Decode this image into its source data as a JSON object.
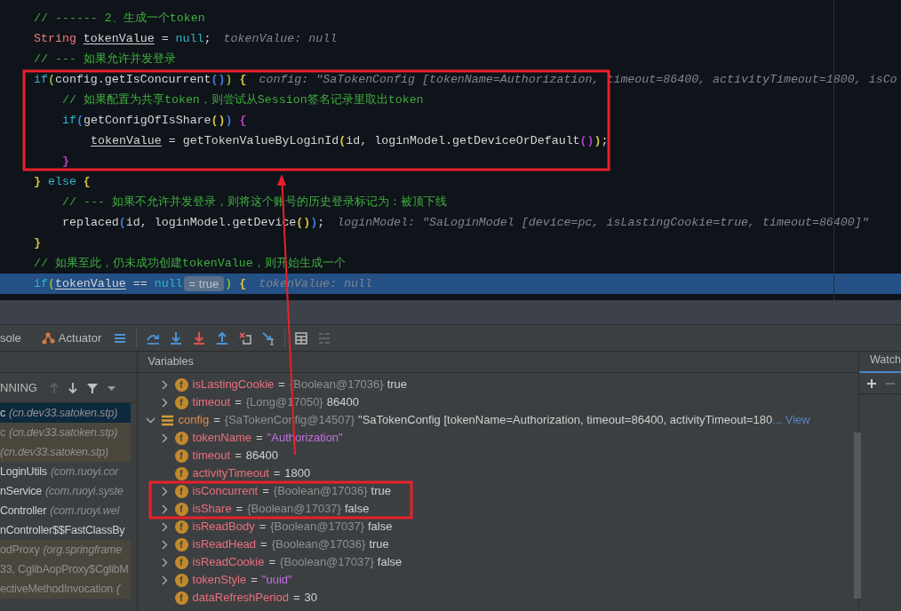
{
  "editor": {
    "lines": [
      {
        "highlighted": false,
        "tokens": [
          {
            "kind": "comment",
            "text": "// ------ 2、生成一个token"
          }
        ]
      },
      {
        "highlighted": false,
        "tokens": [
          {
            "kind": "type",
            "text": "String "
          },
          {
            "kind": "var",
            "text": "tokenValue"
          },
          {
            "kind": "plain",
            "text": " = "
          },
          {
            "kind": "keyword",
            "text": "null"
          },
          {
            "kind": "plain",
            "text": ";"
          },
          {
            "kind": "hint",
            "text": "tokenValue: null"
          }
        ]
      },
      {
        "highlighted": false,
        "tokens": [
          {
            "kind": "comment",
            "text": "// --- 如果允许并发登录"
          }
        ]
      },
      {
        "highlighted": false,
        "tokens": [
          {
            "kind": "keyword",
            "text": "if"
          },
          {
            "kind": "bracket",
            "text": "(",
            "color": "#7fb83a"
          },
          {
            "kind": "plain",
            "text": "config.getIsConcurrent"
          },
          {
            "kind": "bracket",
            "text": "()",
            "color": "#3d7dd8"
          },
          {
            "kind": "bracket",
            "text": ")",
            "color": "#7fb83a"
          },
          {
            "kind": "bracket",
            "text": " {",
            "color": "#d6c43a"
          },
          {
            "kind": "hint",
            "text": "config: \"SaTokenConfig [tokenName=Authorization, timeout=86400, activityTimeout=1800, isCo"
          }
        ],
        "children": [
          {
            "highlighted": false,
            "tokens": [
              {
                "kind": "comment",
                "text": "// 如果配置为共享token，则尝试从Session签名记录里取出token"
              }
            ]
          },
          {
            "highlighted": false,
            "tokens": [
              {
                "kind": "keyword",
                "text": "if"
              },
              {
                "kind": "bracket",
                "text": "(",
                "color": "#3d7dd8"
              },
              {
                "kind": "plain",
                "text": "getConfigOfIsShare"
              },
              {
                "kind": "bracket",
                "text": "()",
                "color": "#d6c43a"
              },
              {
                "kind": "bracket",
                "text": ")",
                "color": "#3d7dd8"
              },
              {
                "kind": "bracket",
                "text": " {",
                "color": "#c73cc7"
              }
            ],
            "children": [
              {
                "highlighted": false,
                "tokens": [
                  {
                    "kind": "var",
                    "text": "tokenValue"
                  },
                  {
                    "kind": "plain",
                    "text": " = getTokenValueByLoginId"
                  },
                  {
                    "kind": "bracket",
                    "text": "(",
                    "color": "#d6c43a"
                  },
                  {
                    "kind": "plain",
                    "text": "id, loginModel.getDeviceOrDefault"
                  },
                  {
                    "kind": "bracket",
                    "text": "()",
                    "color": "#b03cd0"
                  },
                  {
                    "kind": "bracket",
                    "text": ")",
                    "color": "#d6c43a"
                  },
                  {
                    "kind": "plain",
                    "text": ";"
                  }
                ]
              }
            ]
          },
          {
            "highlighted": false,
            "tokens": [
              {
                "kind": "bracket",
                "text": "}",
                "color": "#c73cc7"
              }
            ]
          }
        ]
      },
      {
        "highlighted": false,
        "tokens": [
          {
            "kind": "bracket",
            "text": "}",
            "color": "#d6c43a"
          },
          {
            "kind": "keyword",
            "text": " else"
          },
          {
            "kind": "bracket",
            "text": " {",
            "color": "#d6c43a"
          }
        ],
        "children": [
          {
            "highlighted": false,
            "tokens": [
              {
                "kind": "comment",
                "text": "// --- 如果不允许并发登录，则将这个账号的历史登录标记为：被顶下线"
              }
            ]
          },
          {
            "highlighted": false,
            "tokens": [
              {
                "kind": "plain",
                "text": "replaced"
              },
              {
                "kind": "bracket",
                "text": "(",
                "color": "#3d7dd8"
              },
              {
                "kind": "plain",
                "text": "id, loginModel.getDevice"
              },
              {
                "kind": "bracket",
                "text": "()",
                "color": "#d6c43a"
              },
              {
                "kind": "bracket",
                "text": ")",
                "color": "#3d7dd8"
              },
              {
                "kind": "plain",
                "text": ";"
              },
              {
                "kind": "hint",
                "text": "loginModel: \"SaLoginModel [device=pc, isLastingCookie=true, timeout=86400]\""
              }
            ]
          }
        ]
      },
      {
        "highlighted": false,
        "tokens": [
          {
            "kind": "bracket",
            "text": "}",
            "color": "#d6c43a"
          }
        ]
      },
      {
        "highlighted": false,
        "tokens": [
          {
            "kind": "comment",
            "text": "// 如果至此，仍未成功创建tokenValue，则开始生成一个"
          }
        ]
      },
      {
        "highlighted": true,
        "tokens": [
          {
            "kind": "keyword",
            "text": "if"
          },
          {
            "kind": "bracket",
            "text": "(",
            "color": "#7fb83a"
          },
          {
            "kind": "var",
            "text": "tokenValue"
          },
          {
            "kind": "plain",
            "text": " == "
          },
          {
            "kind": "keyword",
            "text": "null"
          },
          {
            "kind": "inline_value",
            "text": "= true"
          },
          {
            "kind": "bracket",
            "text": ")",
            "color": "#7fb83a"
          },
          {
            "kind": "bracket",
            "text": " {",
            "color": "#d6c43a"
          },
          {
            "kind": "hint",
            "text": "tokenValue: null"
          }
        ]
      }
    ]
  },
  "toolbar": {
    "tabs": [
      {
        "label": "sole",
        "kind": "plain"
      },
      {
        "label": "Actuator",
        "kind": "actuator"
      }
    ]
  },
  "frames": {
    "header": "NNING",
    "items": [
      {
        "name": "c",
        "location": "(cn.dev33.satoken.stp)",
        "library": false,
        "selected": true
      },
      {
        "name": "c",
        "location": "(cn.dev33.satoken.stp)",
        "library": true,
        "selected": false
      },
      {
        "location": "(cn.dev33.satoken.stp)",
        "library": true,
        "selected": false
      },
      {
        "name": "LoginUtils",
        "location": "(com.ruoyi.cor",
        "library": false,
        "selected": false
      },
      {
        "name": "nService",
        "location": "(com.ruoyi.syste",
        "library": false,
        "selected": false
      },
      {
        "name": "Controller",
        "location": "(com.ruoyi.wel",
        "library": false,
        "selected": false
      },
      {
        "name": "nController$$FastClassBy",
        "library": false,
        "selected": false
      },
      {
        "name": "odProxy",
        "location": "(org.springframe",
        "library": true,
        "selected": false
      },
      {
        "name": "33, CglibAopProxy$CglibM",
        "library": true,
        "selected": false
      },
      {
        "name": "ectiveMethodInvocation",
        "location": "(",
        "library": true,
        "selected": false
      }
    ]
  },
  "variables": {
    "title": "Variables",
    "continued_children": [
      {
        "kind": "field",
        "badge": "f",
        "name": "isLastingCookie",
        "operator": "=",
        "type_ref": "{Boolean@17036}",
        "value": "true",
        "is_string": false,
        "expandable": true,
        "expanded": false
      },
      {
        "kind": "field",
        "badge": "f",
        "name": "timeout",
        "operator": "=",
        "type_ref": "{Long@17050}",
        "value": "86400",
        "is_string": false,
        "expandable": true,
        "expanded": false
      }
    ],
    "items": [
      {
        "kind": "object",
        "name": "config",
        "operator": "=",
        "type_ref": "{SaTokenConfig@14507}",
        "value": "\"SaTokenConfig [tokenName=Authorization, timeout=86400, activityTimeout=180",
        "is_string": false,
        "link": "... View",
        "expandable": true,
        "expanded": true,
        "children": [
          {
            "kind": "field",
            "badge": "f",
            "name": "tokenName",
            "operator": "=",
            "value": "\"Authorization\"",
            "is_string": true,
            "expandable": true,
            "expanded": false
          },
          {
            "kind": "field",
            "badge": "f",
            "name": "timeout",
            "operator": "=",
            "value": "86400",
            "is_string": false,
            "expandable": false
          },
          {
            "kind": "field",
            "badge": "f",
            "name": "activityTimeout",
            "operator": "=",
            "value": "1800",
            "is_string": false,
            "expandable": false
          },
          {
            "kind": "field",
            "badge": "f",
            "name": "isConcurrent",
            "operator": "=",
            "type_ref": "{Boolean@17036}",
            "value": "true",
            "is_string": false,
            "expandable": true,
            "expanded": false
          },
          {
            "kind": "field",
            "badge": "f",
            "name": "isShare",
            "operator": "=",
            "type_ref": "{Boolean@17037}",
            "value": "false",
            "is_string": false,
            "expandable": true,
            "expanded": false
          },
          {
            "kind": "field",
            "badge": "f",
            "name": "isReadBody",
            "operator": "=",
            "type_ref": "{Boolean@17037}",
            "value": "false",
            "is_string": false,
            "expandable": true,
            "expanded": false
          },
          {
            "kind": "field",
            "badge": "f",
            "name": "isReadHead",
            "operator": "=",
            "type_ref": "{Boolean@17036}",
            "value": "true",
            "is_string": false,
            "expandable": true,
            "expanded": false
          },
          {
            "kind": "field",
            "badge": "f",
            "name": "isReadCookie",
            "operator": "=",
            "type_ref": "{Boolean@17037}",
            "value": "false",
            "is_string": false,
            "expandable": true,
            "expanded": false
          },
          {
            "kind": "field",
            "badge": "f",
            "name": "tokenStyle",
            "operator": "=",
            "value": "\"uuid\"",
            "is_string": true,
            "expandable": true,
            "expanded": false
          },
          {
            "kind": "field",
            "badge": "f",
            "name": "dataRefreshPeriod",
            "operator": "=",
            "value": "30",
            "is_string": false,
            "expandable": false
          }
        ]
      }
    ]
  },
  "watches": {
    "title": "Watch"
  }
}
